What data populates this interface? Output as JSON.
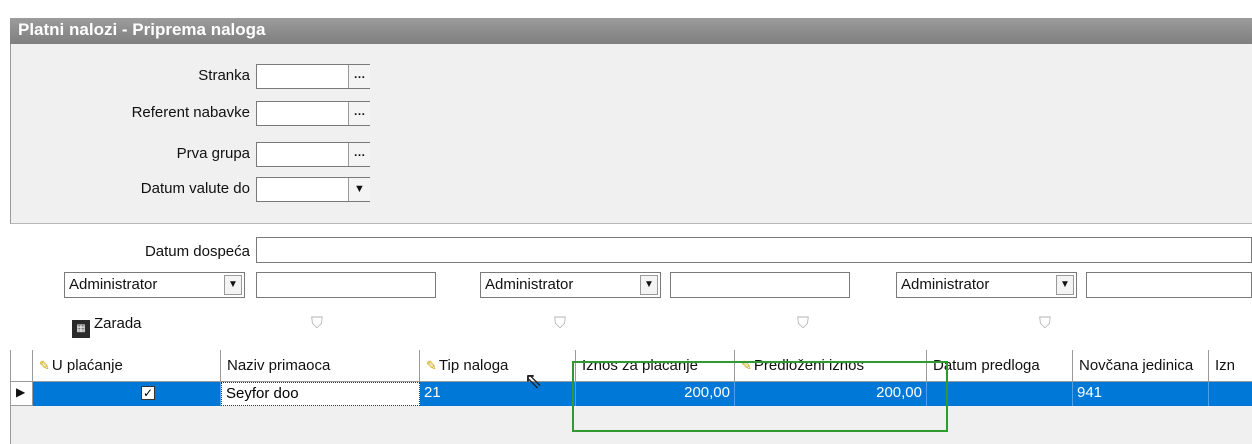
{
  "window": {
    "title": "Platni nalozi - Priprema naloga"
  },
  "filters": {
    "stranka": {
      "label": "Stranka",
      "value": ""
    },
    "referent_nabavke": {
      "label": "Referent nabavke",
      "value": ""
    },
    "prva_grupa": {
      "label": "Prva grupa",
      "value": ""
    },
    "datum_valute_do": {
      "label": "Datum valute do",
      "value": ""
    }
  },
  "datum_dospeca": {
    "label": "Datum dospeća",
    "value": ""
  },
  "user_combos": [
    {
      "value": "Administrator",
      "text": ""
    },
    {
      "value": "Administrator",
      "text": ""
    },
    {
      "value": "Administrator",
      "text": ""
    }
  ],
  "zarada_label": "Zarada",
  "table": {
    "columns": [
      "U plaćanje",
      "Naziv primaoca",
      "Tip naloga",
      "Iznos za placanje",
      "Predloženi iznos",
      "Datum predloga",
      "Novčana jedinica",
      "Izn"
    ],
    "rows": [
      {
        "u_placanje": true,
        "naziv_primaoca": "Seyfor doo",
        "tip_naloga": "21",
        "iznos_za_placanje": "200,00",
        "predlozeni_iznos": "200,00",
        "datum_predloga": "",
        "novcana_jedinica": "941",
        "izn": ""
      }
    ]
  },
  "colors": {
    "title_bar": "#8a8a8a",
    "selection": "#0078d7",
    "highlight_box": "#2f9a2f"
  }
}
